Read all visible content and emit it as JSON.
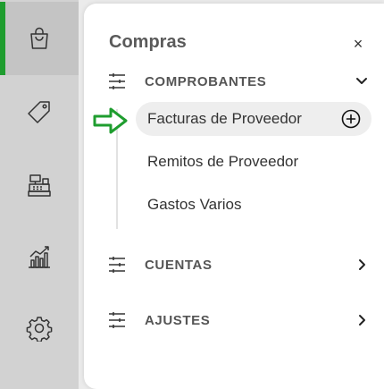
{
  "rail": {
    "items": [
      {
        "icon": "shopping-bag-icon",
        "active": true
      },
      {
        "icon": "tag-icon",
        "active": false
      },
      {
        "icon": "cash-register-icon",
        "active": false
      },
      {
        "icon": "bar-chart-icon",
        "active": false
      },
      {
        "icon": "gear-icon",
        "active": false
      }
    ]
  },
  "panel": {
    "title": "Compras",
    "close_label": "×",
    "sections": [
      {
        "label": "COMPROBANTES",
        "icon": "sliders-icon",
        "expanded": true,
        "items": [
          {
            "label": "Facturas de Proveedor",
            "highlighted": true,
            "action_icon": "add-circle-icon"
          },
          {
            "label": "Remitos de Proveedor"
          },
          {
            "label": "Gastos Varios"
          }
        ]
      },
      {
        "label": "CUENTAS",
        "icon": "sliders-icon",
        "expanded": false
      },
      {
        "label": "AJUSTES",
        "icon": "sliders-icon",
        "expanded": false
      }
    ]
  },
  "colors": {
    "accent_green": "#1f9d2f",
    "rail_bg": "#d2d2d2",
    "rail_active_bg": "#c4c4c4",
    "hover_bg": "#eeeeee"
  }
}
